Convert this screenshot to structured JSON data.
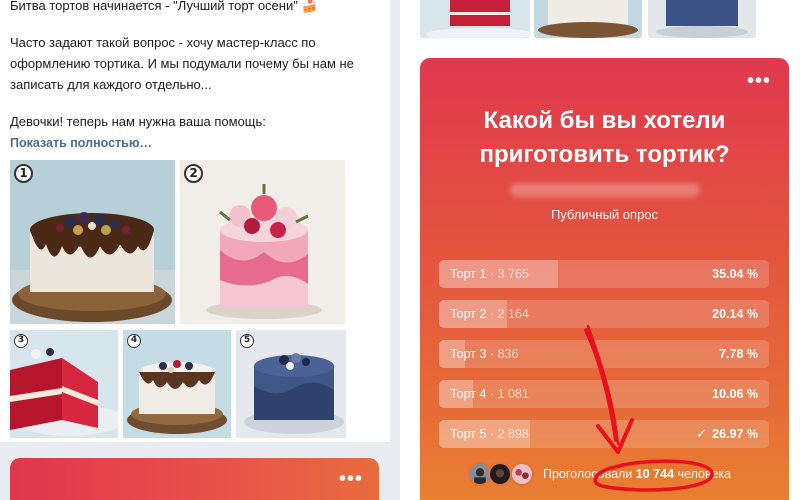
{
  "post": {
    "lines": [
      "Битва тортов начинается - \"Лучший торт осени\" 🍰",
      "Часто задают такой вопрос - хочу мастер-класс по",
      "оформлению тортика. И мы подумали почему бы нам не",
      "записать для каждого отдельно...",
      "Девочки! теперь нам нужна ваша помощь:"
    ],
    "show_more": "Показать полностью…",
    "photo_numbers": [
      "1",
      "2",
      "3",
      "4",
      "5"
    ]
  },
  "poll": {
    "question": "Какой бы вы хотели приготовить тортик?",
    "type_label": "Публичный опрос",
    "options": [
      {
        "label": "Торт 1",
        "count": "3 765",
        "percent": "35.04 %",
        "fraction": 0.3504,
        "selected": false
      },
      {
        "label": "Торт 2",
        "count": "2 164",
        "percent": "20.14 %",
        "fraction": 0.2014,
        "selected": false
      },
      {
        "label": "Торт 3",
        "count": "836",
        "percent": "7.78 %",
        "fraction": 0.0778,
        "selected": false
      },
      {
        "label": "Торт 4",
        "count": "1 081",
        "percent": "10.06 %",
        "fraction": 0.1006,
        "selected": false
      },
      {
        "label": "Торт 5",
        "count": "2 898",
        "percent": "26.97 %",
        "fraction": 0.2697,
        "selected": true
      }
    ],
    "voted_prefix": "Проголосовали",
    "voted_count": "10 744",
    "voted_suffix": "человека"
  },
  "colors": {
    "poll_top": "#e0394f",
    "poll_bottom": "#e9842f",
    "link": "#4a6d93",
    "annotation": "#e8101e"
  }
}
